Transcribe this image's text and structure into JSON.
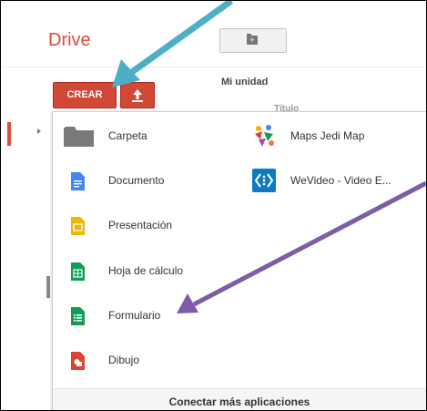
{
  "header": {
    "brand": "Drive",
    "new_folder_icon": "folder-plus-icon"
  },
  "toolbar": {
    "crear_label": "CREAR",
    "upload_icon": "upload-icon"
  },
  "main": {
    "section_title": "Mi unidad",
    "faint_title": "Título"
  },
  "menu": {
    "left_items": [
      {
        "label": "Carpeta",
        "icon": "folder-icon",
        "color": "#7a7a7a"
      },
      {
        "label": "Documento",
        "icon": "document-icon",
        "color": "#4285f4"
      },
      {
        "label": "Presentación",
        "icon": "presentation-icon",
        "color": "#f4b400"
      },
      {
        "label": "Hoja de cálculo",
        "icon": "spreadsheet-icon",
        "color": "#0f9d58"
      },
      {
        "label": "Formulario",
        "icon": "form-icon",
        "color": "#0f9d58"
      },
      {
        "label": "Dibujo",
        "icon": "drawing-icon",
        "color": "#db4437"
      }
    ],
    "right_items": [
      {
        "label": "Maps Jedi Map",
        "icon": "maps-jedi-map-icon"
      },
      {
        "label": "WeVideo - Video E...",
        "icon": "wevideo-icon",
        "color": "#0c7bc0"
      }
    ],
    "footer_label": "Conectar más aplicaciones"
  },
  "annotations": {
    "arrow_colors": [
      "#4eaec5",
      "#7b5ea7"
    ]
  }
}
